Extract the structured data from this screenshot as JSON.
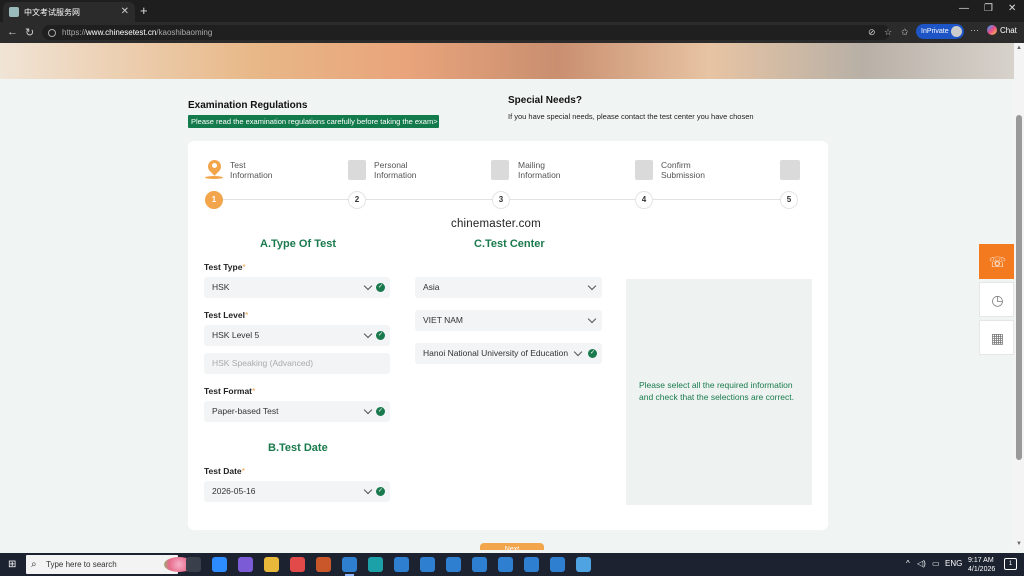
{
  "browser": {
    "tab_title": "中文考试服务网",
    "tab_close": "✕",
    "new_tab": "+",
    "url_scheme": "https://",
    "url_host": "www.chinesetest.cn",
    "url_path": "/kaoshibaoming",
    "inprivate_label": "InPrivate",
    "chat_label": "Chat",
    "more": "···",
    "window_controls": [
      "—",
      "❐",
      "✕"
    ]
  },
  "regulations": {
    "title": "Examination Regulations",
    "note": "Please read the examination regulations carefully before taking the exam>"
  },
  "special_needs": {
    "title": "Special Needs?",
    "text": "If you have special needs, please contact the test center you have chosen"
  },
  "steps": [
    {
      "number": "1",
      "line1": "Test",
      "line2": "Information",
      "icon": "location-pin-icon"
    },
    {
      "number": "2",
      "line1": "Personal",
      "line2": "Information",
      "icon": "personal-form-icon"
    },
    {
      "number": "3",
      "line1": "Mailing",
      "line2": "Information",
      "icon": "image-icon"
    },
    {
      "number": "4",
      "line1": "Confirm",
      "line2": "Submission",
      "icon": "document-check-icon"
    },
    {
      "number": "5",
      "line1": "",
      "line2": "",
      "icon": "monitor-check-icon"
    }
  ],
  "watermark": "chinemaster.com",
  "type_of_test": {
    "title": "A.Type Of Test",
    "test_type_label": "Test Type",
    "test_type_value": "HSK",
    "test_level_label": "Test Level",
    "test_level_value": "HSK Level 5",
    "speaking_value": "HSK Speaking (Advanced)",
    "test_format_label": "Test Format",
    "test_format_value": "Paper-based Test"
  },
  "test_date": {
    "title": "B.Test Date",
    "label": "Test Date",
    "value": "2026-05-16"
  },
  "test_center": {
    "title": "C.Test Center",
    "region": "Asia",
    "country": "VIET NAM",
    "center": "Hanoi National University of Education"
  },
  "required_mark": "*",
  "info_message": "Please select all the required information and check that the selections are correct.",
  "next_label": "Next",
  "taskbar": {
    "search_placeholder": "Type here to search",
    "language": "ENG",
    "time": "9:17 AM",
    "date": "4/1/2026",
    "notification_count": "1",
    "app_colors": [
      "#3a3f4c",
      "#2d8cff",
      "#7b5cd6",
      "#e8b83a",
      "#e24a4a",
      "#c9572a",
      "#2f7fd1",
      "#1da1a8",
      "#2f7fd1",
      "#2f7fd1",
      "#2f7fd1",
      "#2f7fd1",
      "#2f7fd1",
      "#2f7fd1",
      "#2f7fd1",
      "#4ea3e0"
    ]
  },
  "colors": {
    "accent_green": "#1b7a4d",
    "accent_orange": "#f2a54a",
    "float_orange": "#f37a1f"
  }
}
